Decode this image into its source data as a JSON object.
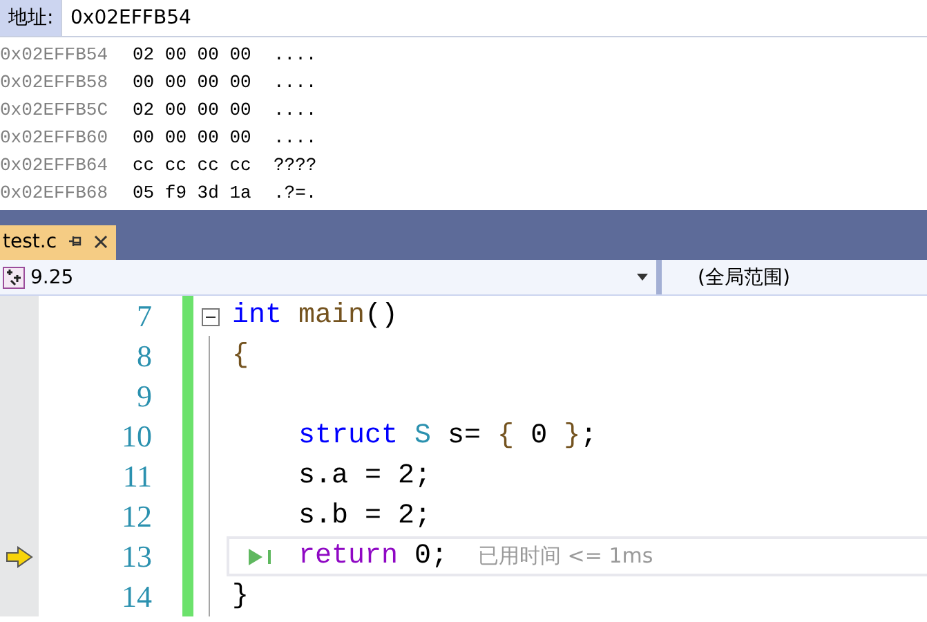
{
  "address_bar": {
    "label": "地址:",
    "value": "0x02EFFB54"
  },
  "memory_rows": [
    {
      "address": "0x02EFFB54",
      "bytes": "02 00 00 00",
      "ascii": "...."
    },
    {
      "address": "0x02EFFB58",
      "bytes": "00 00 00 00",
      "ascii": "...."
    },
    {
      "address": "0x02EFFB5C",
      "bytes": "02 00 00 00",
      "ascii": "...."
    },
    {
      "address": "0x02EFFB60",
      "bytes": "00 00 00 00",
      "ascii": "...."
    },
    {
      "address": "0x02EFFB64",
      "bytes": "cc cc cc cc",
      "ascii": "????"
    },
    {
      "address": "0x02EFFB68",
      "bytes": "05 f9 3d 1a",
      "ascii": ".?=."
    }
  ],
  "tabs": [
    {
      "label": "test.c",
      "selected": true
    }
  ],
  "nav_bar": {
    "project": "9.25",
    "scope": "(全局范围)"
  },
  "code_lines": [
    {
      "number": "7",
      "current": false,
      "fold": true,
      "indented": false,
      "tokens": [
        {
          "kind": "keyword",
          "text": "int"
        },
        {
          "kind": "function",
          "text": "main",
          "space_before": true
        },
        {
          "kind": "plain",
          "text": "()"
        }
      ]
    },
    {
      "number": "8",
      "current": false,
      "fold": false,
      "indented": false,
      "tokens": [
        {
          "kind": "function",
          "text": "{"
        }
      ]
    },
    {
      "number": "9",
      "current": false,
      "fold": false
    },
    {
      "number": "10",
      "current": false,
      "fold": false,
      "indented": true,
      "tokens": [
        {
          "kind": "keyword",
          "text": "struct"
        },
        {
          "kind": "type",
          "text": "S",
          "space_before": true
        },
        {
          "kind": "plain",
          "text": "s=",
          "space_before": true
        },
        {
          "kind": "function",
          "text": "{",
          "space_before": true
        },
        {
          "kind": "plain",
          "text": "0",
          "space_before": true
        },
        {
          "kind": "function",
          "text": "}",
          "space_before": true
        },
        {
          "kind": "plain",
          "text": ";"
        }
      ]
    },
    {
      "number": "11",
      "current": false,
      "fold": false,
      "indented": true,
      "tokens": [
        {
          "kind": "plain",
          "text": "s.a = 2;"
        }
      ]
    },
    {
      "number": "12",
      "current": false,
      "fold": false,
      "indented": true,
      "tokens": [
        {
          "kind": "plain",
          "text": "s.b = 2;"
        }
      ]
    },
    {
      "number": "13",
      "current": true,
      "fold": false,
      "indented": true,
      "tokens": [
        {
          "kind": "control",
          "text": "return"
        },
        {
          "kind": "plain",
          "text": "0;",
          "space_before": true
        }
      ],
      "hint": "已用时间 <= 1ms"
    },
    {
      "number": "14",
      "current": false,
      "fold": false,
      "indented": false,
      "tokens": [
        {
          "kind": "plain",
          "text": "}"
        }
      ]
    }
  ]
}
